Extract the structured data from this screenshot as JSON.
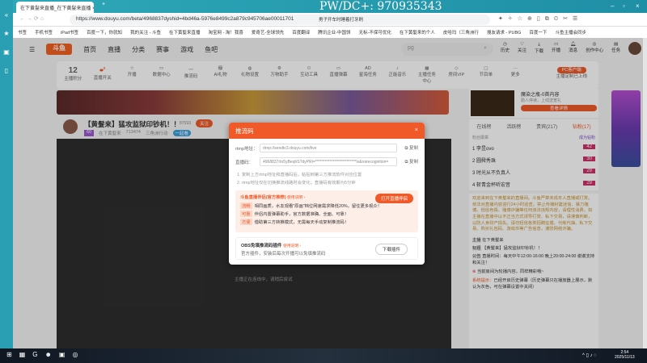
{
  "browser": {
    "tab_title": "在下黄髮来直播_在下黄髮来直播",
    "watermark": "PW/DC+:  970935343",
    "url": "https://www.douyu.com/beta/4968837dyshid=4bd46a-5976e8499c2a879c945706ae00011701",
    "news": "男子开车时睡着打牙刷",
    "bookmarks": [
      "书签",
      "手机书签",
      "iPad书签",
      "百度一下，你就知",
      "我的关注 - 斗鱼",
      "在下黄髮来直播",
      "淘宝网 - 淘！我喜",
      "爱奇艺-全球领先",
      "百度翻译",
      "腾讯企业-中国领",
      "无标-不保可优化",
      "在下黄髮来的个人",
      "皮哈玛（三角洲行",
      "搜友请求 - PUBG",
      "百度一下",
      "斗鱼主播会同步"
    ]
  },
  "site": {
    "logo": "斗鱼",
    "nav": [
      "首页",
      "直播",
      "分类",
      "赛事",
      "游戏",
      "鱼吧"
    ],
    "search_placeholder": "pg",
    "top_icons": [
      "历史",
      "关注",
      "下载",
      "开播",
      "消息",
      "创作中心",
      "任务"
    ],
    "score": "12",
    "score_label": "主播积分",
    "tools": [
      "直播开关",
      "开播",
      "数据中心",
      "推流码",
      "AI礼物",
      "礼物设置",
      "万物助手",
      "互动工具",
      "直播弹幕",
      "星海任务",
      "正能音乐",
      "主播任务中心",
      "房间VIP",
      "节目单",
      "更多"
    ],
    "pc_client": "PC客户端",
    "pc_client_sub": "主播定制已上线",
    "tools_badge": "8"
  },
  "streamer": {
    "title": "【黄髮来】猛攻监狱印钞机！！",
    "follow_count": "87593",
    "follow": "关注",
    "level": "60",
    "name": "在下黄髮来",
    "heat": "713474",
    "category": "三角洲行动",
    "tag": "一起看",
    "offline_text": "主播正在连线中，请稍后尝试"
  },
  "ad": {
    "title": "魔染之瓶-0首内容",
    "desc": "勤人停读，上线送宽礼",
    "btn": "查看详情"
  },
  "rank": {
    "tabs": [
      "在线榜",
      "活跃榜",
      "贵宾(217)",
      "钻粉(17)"
    ],
    "fans": "粉丝徽章",
    "become": "成为钻粉",
    "items": [
      {
        "n": "1",
        "name": "李昱ovo",
        "lv": "42"
      },
      {
        "n": "2",
        "name": "圆舜秀珠",
        "lv": "30"
      },
      {
        "n": "3",
        "name": "时光从不负真人",
        "lv": "29"
      },
      {
        "n": "4",
        "name": "斩青金杯听宏音",
        "lv": "29"
      }
    ]
  },
  "chat": {
    "notice": "欢迎来到在下黄髮来的直播间。斗鱼严禁未成年人直播或打赏。依法对直播内容进行24小时巡查，禁止传播封建迷信、暴力赌博、低俗色情、赌博诈骗等任何违法违规内容，请理性消费。如主播在直播中以不正当方式诱导打赏、私下交易，请谨慎判断，以防人身财产损失。请勿轻信各类招聘征婚、代练代抽、私下交易、购买礼包码、游戏币等广告信息，谨防网络诈骗。",
    "host_l": "主播",
    "host": "在下黄髮来",
    "title_l": "标题",
    "title": "【黄髮来】猛攻监狱印钞机！！",
    "ann_l": "公告",
    "ann": "直播时间：每天中午12:00-16:00 晚上20:00-24:00 谢谢支持和关注！",
    "sys1": "当前房间为轮播内容，同样精彩哦~",
    "sys_l": "系统提示：",
    "sys2": "已经开启历史弹幕（历史弹幕只在播放器上展示，默认为灰色，可在弹幕设置中关闭）"
  },
  "modal": {
    "title": "推流码",
    "rtmp_label": "rtmp地址：",
    "rtmp": "rtmp://sendtc3.douyu.com/live",
    "code_label": "直播码：",
    "code": "4968837rIn5yBeqhS?dyPRI=**************************lv&roirecognition=",
    "copy": "复制",
    "tip1": "1. 复制上方rtmp地址和直播码后，粘贴到第三方推流软件对应位置",
    "tip2": "2. rtmp地址仅在切换推流线路时会变化；直播码有效期为5分钟",
    "companion": "斗鱼直播伴侣(官方推荐)",
    "usage": "使用说明 ›",
    "open": "打开直播伴侣",
    "feats": [
      {
        "tag": "流畅",
        "text": "相同画质，水友观看\"原画\"档位网速需求降低20%，留住更多观众！"
      },
      {
        "tag": "可靠",
        "text": "伴侣内置弹幕助手，官方数据准确、全面、可靠！"
      },
      {
        "tag": "方便",
        "text": "借助第三方转推模式，无需每天手动复制推流码！"
      }
    ],
    "obs": "OBS免填推流码插件",
    "obs_desc": "官方插件，安装后每次开播可以免填推流码",
    "download": "下载插件"
  },
  "taskbar": {
    "time": "2:54",
    "date": "2025/11/13"
  }
}
